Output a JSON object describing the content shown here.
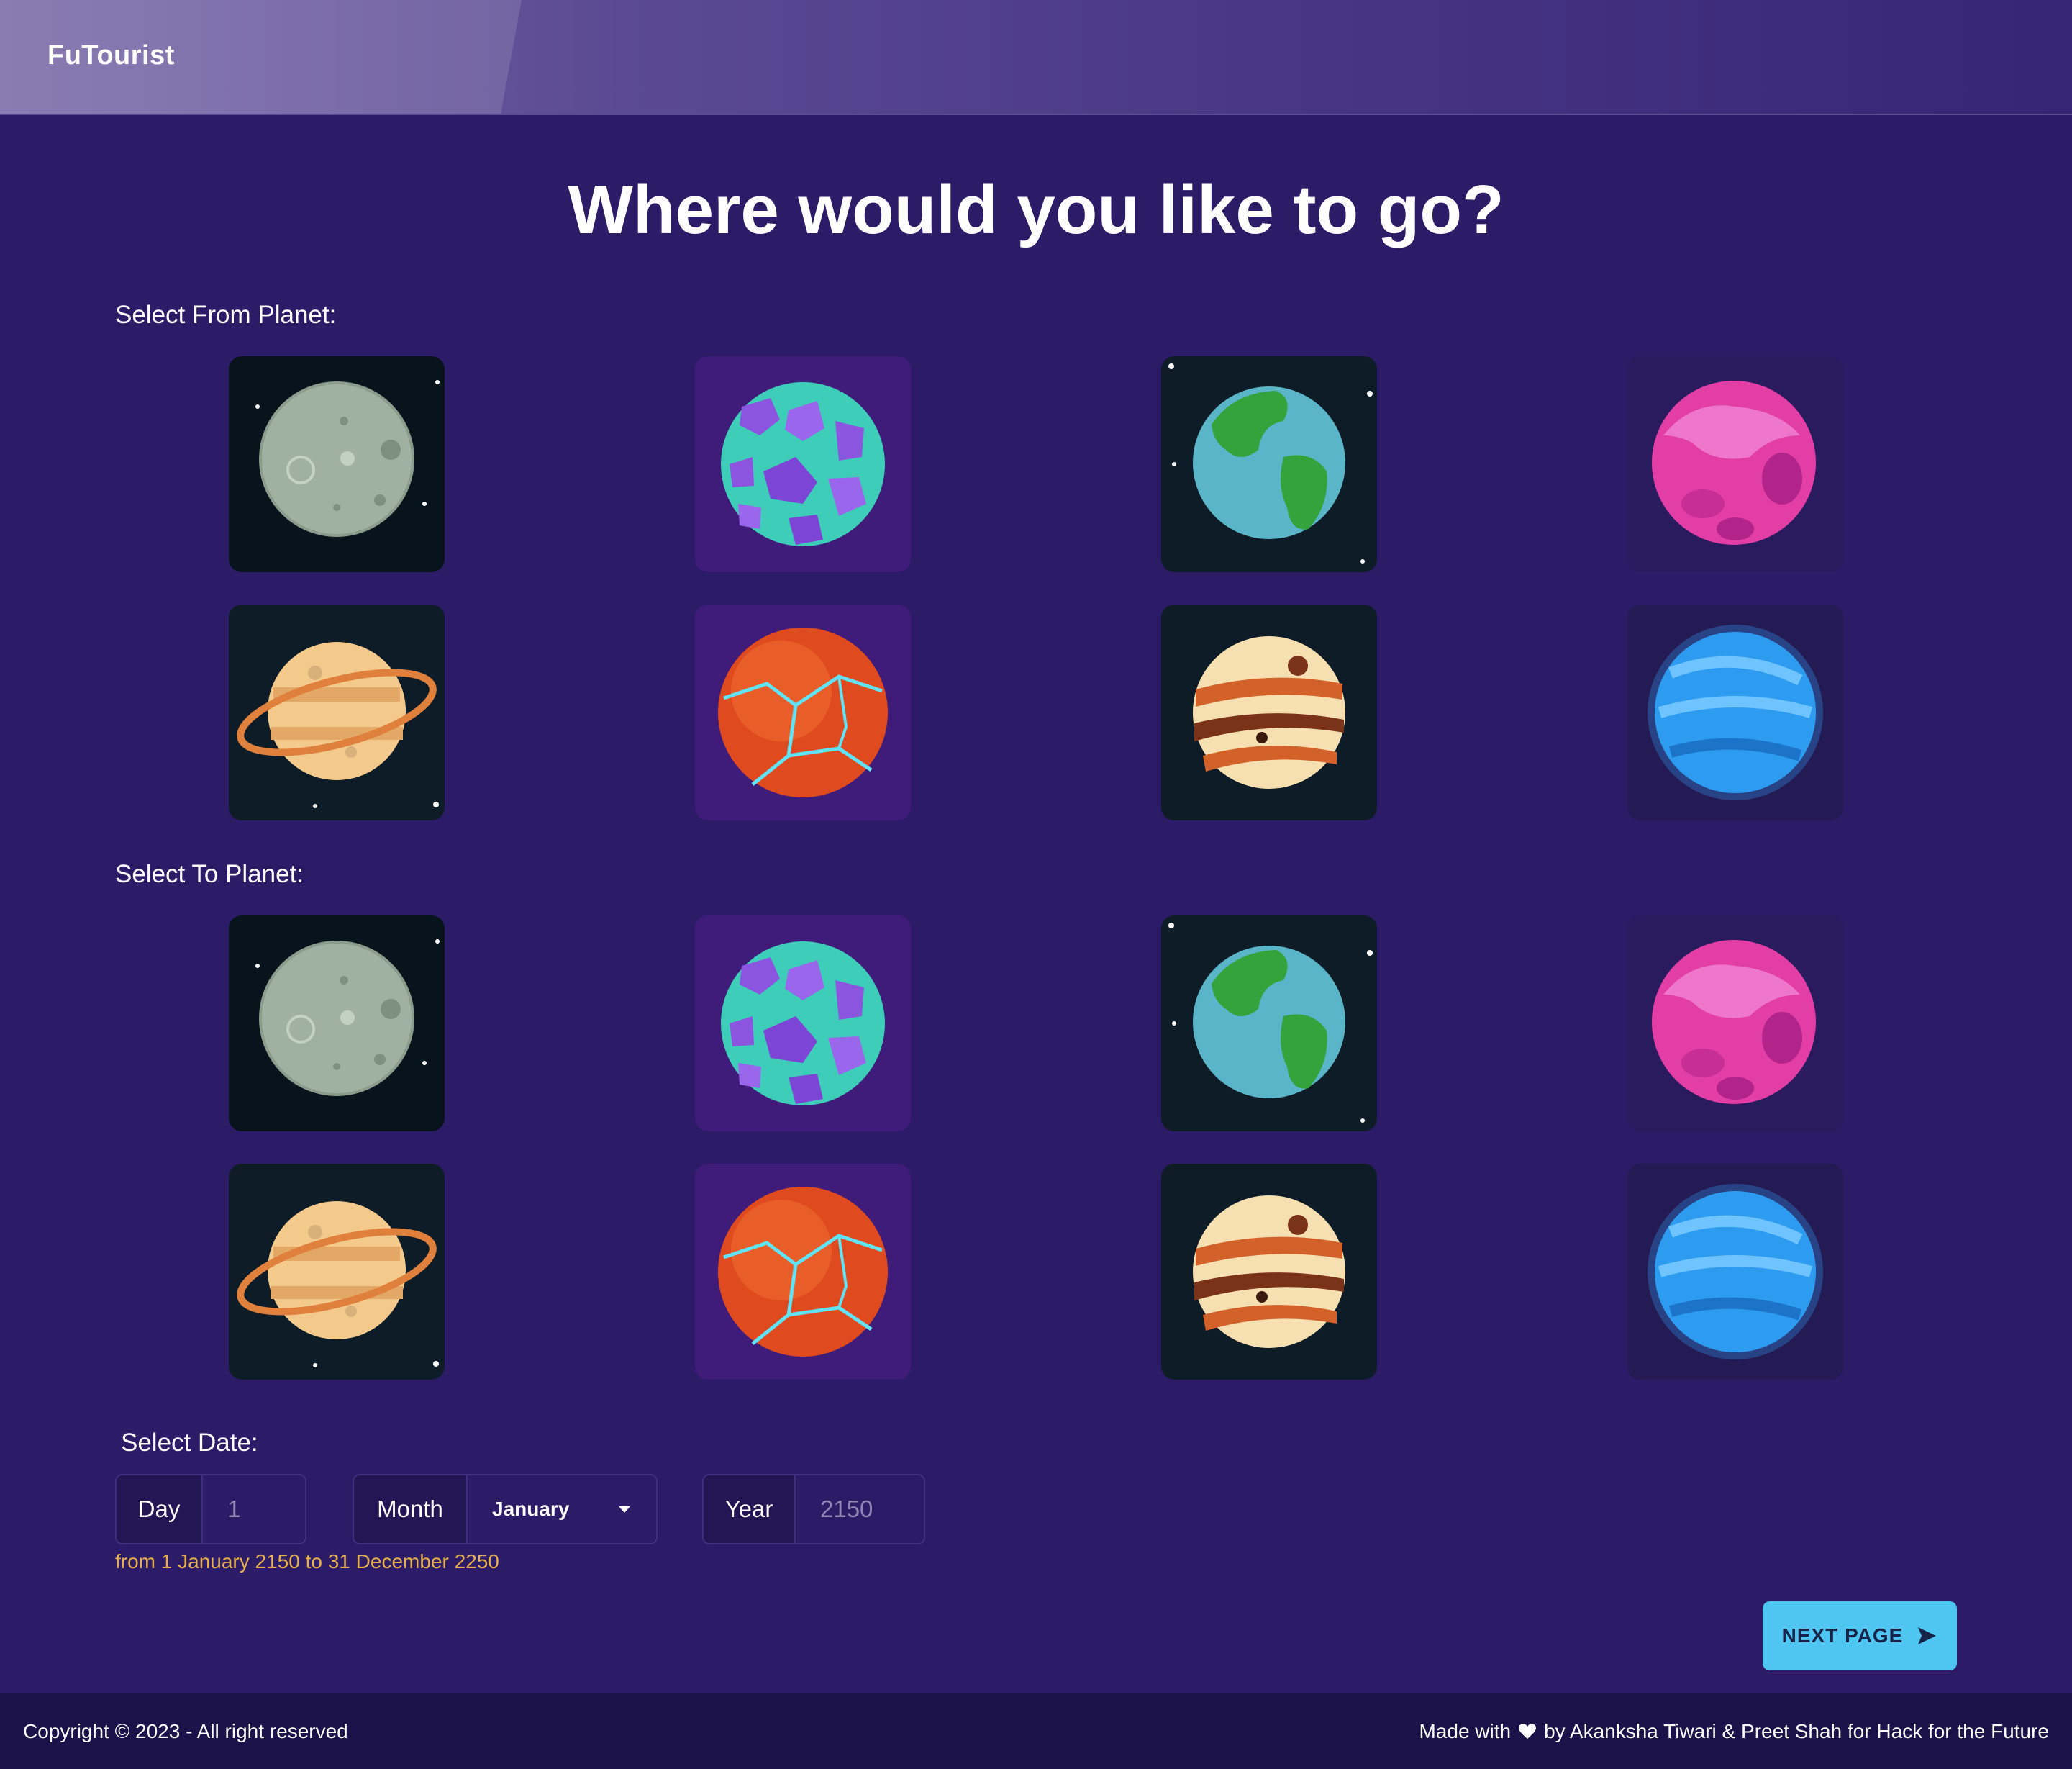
{
  "header": {
    "brand": "FuTourist"
  },
  "main": {
    "title": "Where would you like to go?",
    "from_label": "Select From Planet:",
    "to_label": "Select To Planet:",
    "planets": [
      {
        "id": "moon",
        "icon": "moon-planet-icon"
      },
      {
        "id": "crystal",
        "icon": "crystal-planet-icon"
      },
      {
        "id": "earth",
        "icon": "earth-planet-icon"
      },
      {
        "id": "pink",
        "icon": "pink-planet-icon"
      },
      {
        "id": "saturn",
        "icon": "ringed-planet-icon"
      },
      {
        "id": "lava",
        "icon": "lava-planet-icon"
      },
      {
        "id": "jupiter",
        "icon": "striped-planet-icon"
      },
      {
        "id": "blue",
        "icon": "blue-planet-icon"
      }
    ],
    "date": {
      "label": "Select Date:",
      "day_label": "Day",
      "day_placeholder": "1",
      "month_label": "Month",
      "month_value": "January",
      "year_label": "Year",
      "year_placeholder": "2150",
      "hint": "from 1 January 2150 to 31 December 2250"
    },
    "next_button": "NEXT PAGE"
  },
  "footer": {
    "copyright": "Copyright © 2023 - All right reserved",
    "made_with": "Made with",
    "credit": "by Akanksha Tiwari & Preet Shah for Hack for the Future"
  },
  "colors": {
    "background": "#2c1b67",
    "button": "#4fc6f2",
    "hint": "#e8b04a",
    "footer": "#1b1249"
  }
}
